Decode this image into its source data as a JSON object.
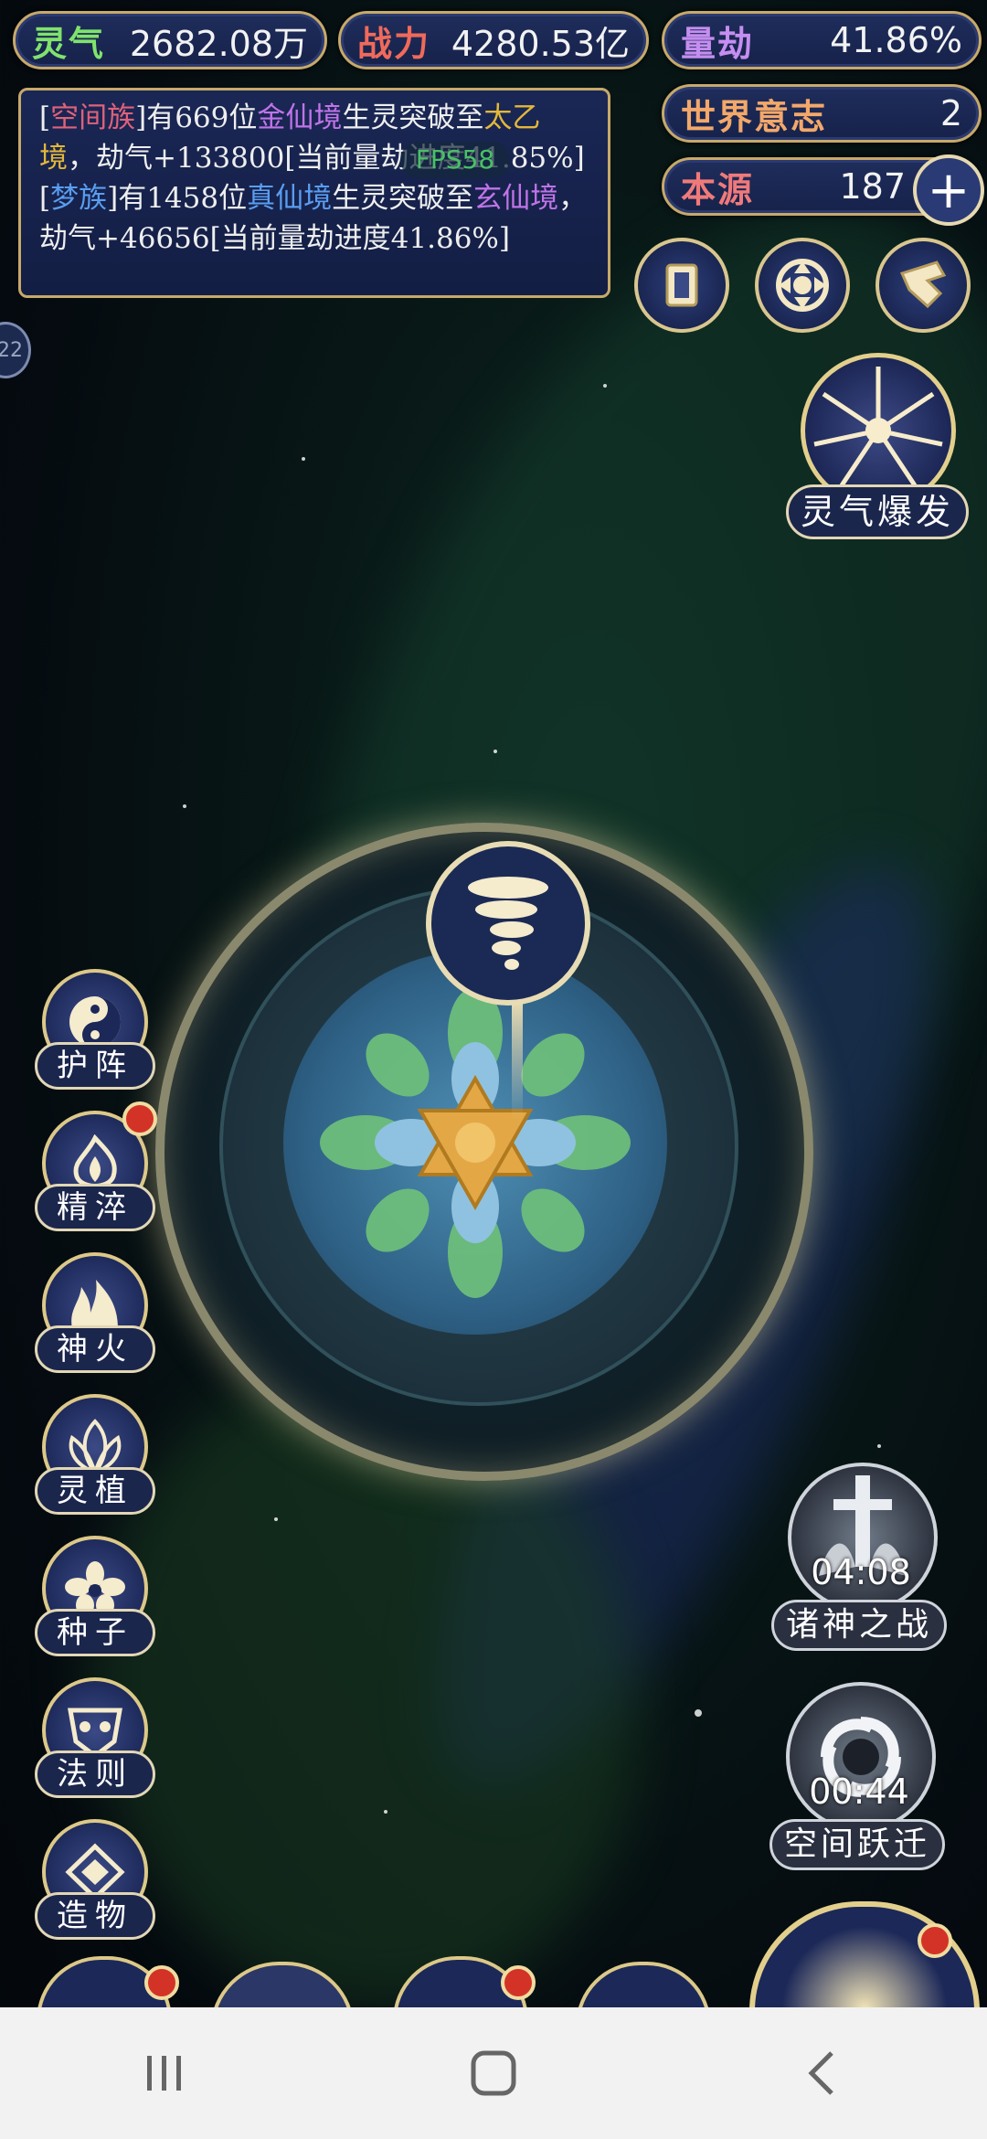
{
  "resources": {
    "lingqi": {
      "label": "灵气",
      "value": "2682.08万"
    },
    "zhanli": {
      "label": "战力",
      "value": "4280.53亿"
    },
    "liangjie": {
      "label": "量劫",
      "value": "41.86%"
    },
    "world_will": {
      "label": "世界意志",
      "value": "2"
    },
    "benyuan": {
      "label": "本源",
      "value": "187"
    }
  },
  "messages": {
    "m1_p1": "[",
    "m1_race": "空间族",
    "m1_p2": "]有669位",
    "m1_realm": "金仙境",
    "m1_p3": "生灵突破至",
    "m1_target": "太乙境",
    "m1_p4": "，劫气+133800[当前量劫进度41.85%]",
    "m2_p1": "[",
    "m2_race": "梦族",
    "m2_p2": "]有1458位",
    "m2_realm": "真仙境",
    "m2_p3": "生灵突破至",
    "m2_target": "玄仙境",
    "m2_p4": "，劫气+46656[当前量劫进度41.86%]"
  },
  "fps": "FPS58",
  "side_badge": "22",
  "burst_label": "灵气爆发",
  "skills": [
    "护阵",
    "精淬",
    "神火",
    "灵植",
    "种子",
    "法则",
    "造物"
  ],
  "timers": [
    {
      "time": "04:08",
      "label": "诸神之战"
    },
    {
      "time": "00:44",
      "label": "空间跃迁"
    }
  ],
  "colors": {
    "race1": "#e0617a",
    "realm_purple": "#c074e8",
    "target_gold": "#e2b73a",
    "race2_blue": "#5a9df0",
    "notification": "#d33326",
    "fps_green": "#49c066"
  },
  "icons": [
    "card-icon",
    "vortex-icon",
    "hand-icon",
    "tornado-icon",
    "yin-yang-icon",
    "flame-icon",
    "lotus-icon",
    "leaf-icon",
    "flower-icon",
    "mask-icon",
    "diamond-icon",
    "sword-icon",
    "spiral-icon"
  ],
  "nav": {
    "recent": "recent-apps",
    "home": "home",
    "back": "back"
  }
}
